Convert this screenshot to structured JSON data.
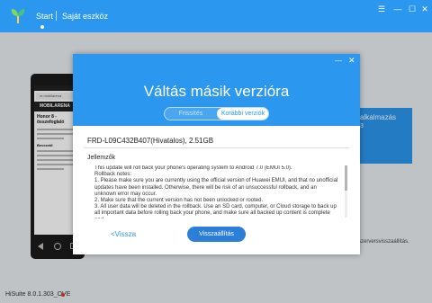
{
  "nav": {
    "start": "Start",
    "my_device": "Saját eszköz"
  },
  "background": {
    "phone": {
      "url": "m.mobilarena",
      "brand": "MOBILARENA",
      "article_title": "Honor 8 - összefoglaló",
      "section": "Bevezető"
    },
    "card_label": "alkalmazás",
    "card_sub": "3",
    "small_text": "szerversvisszaállítás."
  },
  "dialog": {
    "title": "Váltás másik verzióra",
    "tabs": [
      "Frissítés",
      "Korábbi verziók"
    ],
    "active_tab": "Korábbi verziók",
    "version": "FRD-L09C432B407(Hivatalos), 2.51GB",
    "features_label": "Jellemzők",
    "notes": [
      "This update will roll back your phone's operating system to Android 7.0 (EMUI 5.0).",
      "Rollback notes:",
      "1. Please make sure you are currently using the official version of Huawei EMUI, and that no unofficial updates have been installed. Otherwise, there will be risk of an unsuccessful rollback, and an unknown error may occur.",
      "2. Make sure that the current version has not been unlocked or rooted.",
      "3. All user data will be deleted in the rollback. Use an SD card, computer, or Cloud storage to back up all important data before rolling back your phone, and make sure all backed up content is complete and"
    ],
    "back_label": "<Vissza",
    "rollback_label": "Visszaállítás"
  },
  "footer": {
    "version": "HiSuite 8.0.1.303_OVE"
  },
  "colors": {
    "accent": "#2b97ee",
    "button": "#2b7fd9",
    "status_dot": "#e53c2f"
  }
}
